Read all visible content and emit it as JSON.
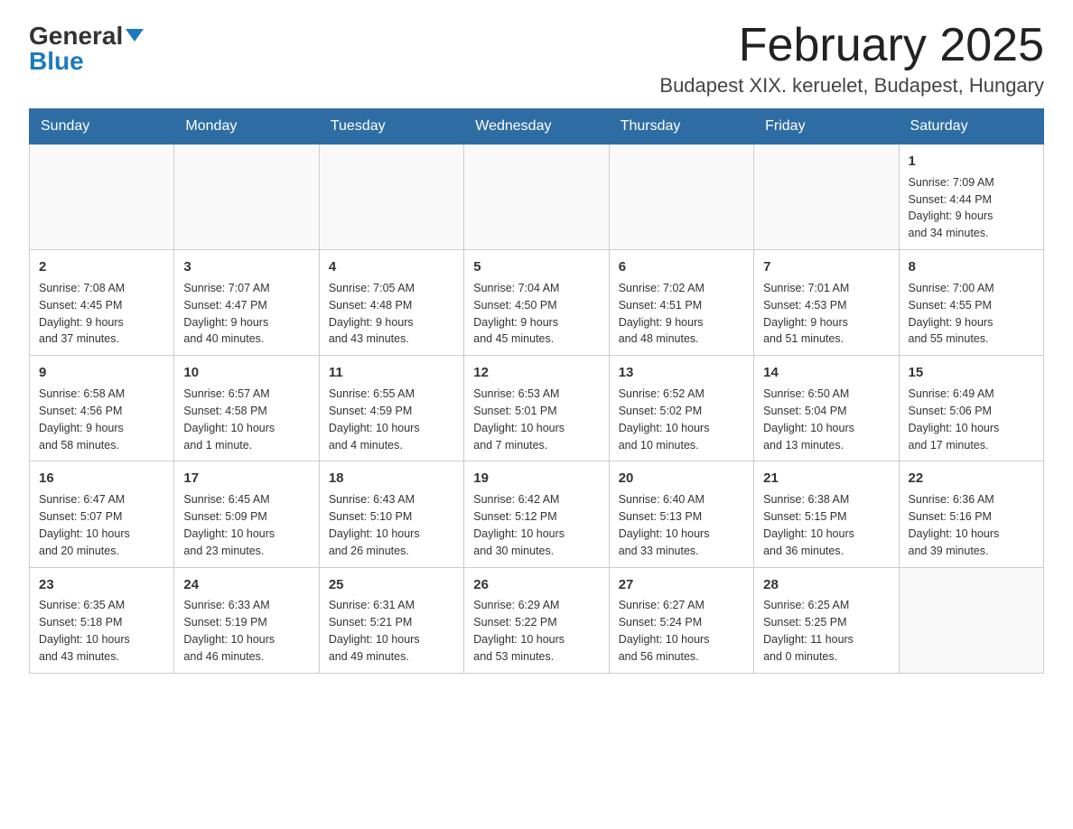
{
  "header": {
    "logo_general": "General",
    "logo_blue": "Blue",
    "month_year": "February 2025",
    "location": "Budapest XIX. keruelet, Budapest, Hungary"
  },
  "weekdays": [
    "Sunday",
    "Monday",
    "Tuesday",
    "Wednesday",
    "Thursday",
    "Friday",
    "Saturday"
  ],
  "rows": [
    [
      {
        "day": "",
        "info": ""
      },
      {
        "day": "",
        "info": ""
      },
      {
        "day": "",
        "info": ""
      },
      {
        "day": "",
        "info": ""
      },
      {
        "day": "",
        "info": ""
      },
      {
        "day": "",
        "info": ""
      },
      {
        "day": "1",
        "info": "Sunrise: 7:09 AM\nSunset: 4:44 PM\nDaylight: 9 hours\nand 34 minutes."
      }
    ],
    [
      {
        "day": "2",
        "info": "Sunrise: 7:08 AM\nSunset: 4:45 PM\nDaylight: 9 hours\nand 37 minutes."
      },
      {
        "day": "3",
        "info": "Sunrise: 7:07 AM\nSunset: 4:47 PM\nDaylight: 9 hours\nand 40 minutes."
      },
      {
        "day": "4",
        "info": "Sunrise: 7:05 AM\nSunset: 4:48 PM\nDaylight: 9 hours\nand 43 minutes."
      },
      {
        "day": "5",
        "info": "Sunrise: 7:04 AM\nSunset: 4:50 PM\nDaylight: 9 hours\nand 45 minutes."
      },
      {
        "day": "6",
        "info": "Sunrise: 7:02 AM\nSunset: 4:51 PM\nDaylight: 9 hours\nand 48 minutes."
      },
      {
        "day": "7",
        "info": "Sunrise: 7:01 AM\nSunset: 4:53 PM\nDaylight: 9 hours\nand 51 minutes."
      },
      {
        "day": "8",
        "info": "Sunrise: 7:00 AM\nSunset: 4:55 PM\nDaylight: 9 hours\nand 55 minutes."
      }
    ],
    [
      {
        "day": "9",
        "info": "Sunrise: 6:58 AM\nSunset: 4:56 PM\nDaylight: 9 hours\nand 58 minutes."
      },
      {
        "day": "10",
        "info": "Sunrise: 6:57 AM\nSunset: 4:58 PM\nDaylight: 10 hours\nand 1 minute."
      },
      {
        "day": "11",
        "info": "Sunrise: 6:55 AM\nSunset: 4:59 PM\nDaylight: 10 hours\nand 4 minutes."
      },
      {
        "day": "12",
        "info": "Sunrise: 6:53 AM\nSunset: 5:01 PM\nDaylight: 10 hours\nand 7 minutes."
      },
      {
        "day": "13",
        "info": "Sunrise: 6:52 AM\nSunset: 5:02 PM\nDaylight: 10 hours\nand 10 minutes."
      },
      {
        "day": "14",
        "info": "Sunrise: 6:50 AM\nSunset: 5:04 PM\nDaylight: 10 hours\nand 13 minutes."
      },
      {
        "day": "15",
        "info": "Sunrise: 6:49 AM\nSunset: 5:06 PM\nDaylight: 10 hours\nand 17 minutes."
      }
    ],
    [
      {
        "day": "16",
        "info": "Sunrise: 6:47 AM\nSunset: 5:07 PM\nDaylight: 10 hours\nand 20 minutes."
      },
      {
        "day": "17",
        "info": "Sunrise: 6:45 AM\nSunset: 5:09 PM\nDaylight: 10 hours\nand 23 minutes."
      },
      {
        "day": "18",
        "info": "Sunrise: 6:43 AM\nSunset: 5:10 PM\nDaylight: 10 hours\nand 26 minutes."
      },
      {
        "day": "19",
        "info": "Sunrise: 6:42 AM\nSunset: 5:12 PM\nDaylight: 10 hours\nand 30 minutes."
      },
      {
        "day": "20",
        "info": "Sunrise: 6:40 AM\nSunset: 5:13 PM\nDaylight: 10 hours\nand 33 minutes."
      },
      {
        "day": "21",
        "info": "Sunrise: 6:38 AM\nSunset: 5:15 PM\nDaylight: 10 hours\nand 36 minutes."
      },
      {
        "day": "22",
        "info": "Sunrise: 6:36 AM\nSunset: 5:16 PM\nDaylight: 10 hours\nand 39 minutes."
      }
    ],
    [
      {
        "day": "23",
        "info": "Sunrise: 6:35 AM\nSunset: 5:18 PM\nDaylight: 10 hours\nand 43 minutes."
      },
      {
        "day": "24",
        "info": "Sunrise: 6:33 AM\nSunset: 5:19 PM\nDaylight: 10 hours\nand 46 minutes."
      },
      {
        "day": "25",
        "info": "Sunrise: 6:31 AM\nSunset: 5:21 PM\nDaylight: 10 hours\nand 49 minutes."
      },
      {
        "day": "26",
        "info": "Sunrise: 6:29 AM\nSunset: 5:22 PM\nDaylight: 10 hours\nand 53 minutes."
      },
      {
        "day": "27",
        "info": "Sunrise: 6:27 AM\nSunset: 5:24 PM\nDaylight: 10 hours\nand 56 minutes."
      },
      {
        "day": "28",
        "info": "Sunrise: 6:25 AM\nSunset: 5:25 PM\nDaylight: 11 hours\nand 0 minutes."
      },
      {
        "day": "",
        "info": ""
      }
    ]
  ]
}
